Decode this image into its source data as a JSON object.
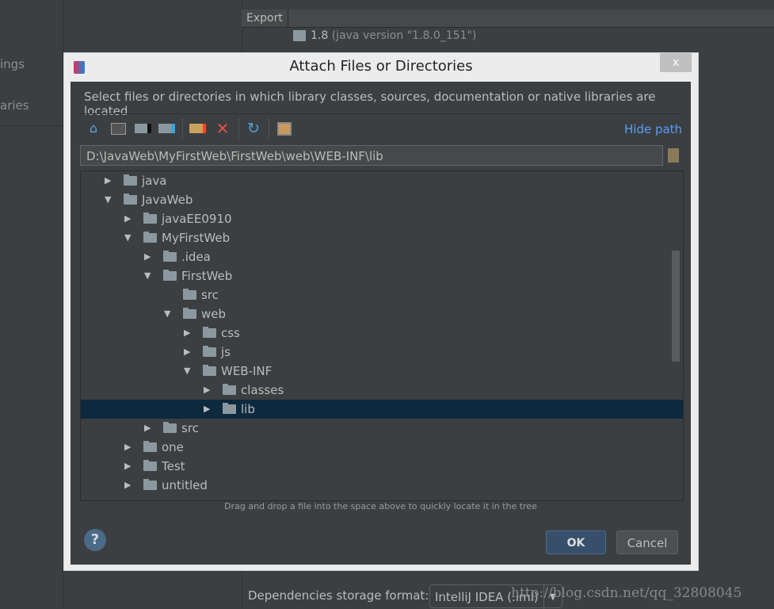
{
  "background": {
    "left_items": [
      "ings",
      "aries"
    ],
    "export_header": "Export",
    "jdk": {
      "name": "1.8",
      "version": "(java version \"1.8.0_151\")"
    },
    "dependencies_label": "Dependencies storage format:",
    "dependencies_value": "IntelliJ IDEA (.iml)",
    "watermark": "http://blog.csdn.net/qq_32808045"
  },
  "dialog": {
    "title": "Attach Files or Directories",
    "close": "x",
    "description": "Select files or directories in which library classes, sources, documentation or native libraries are located",
    "toolbar": {
      "icons": [
        "home-icon",
        "desktop-icon",
        "project-folder-icon",
        "module-folder-icon",
        "new-folder-icon",
        "delete-icon",
        "refresh-icon",
        "show-hidden-icon"
      ],
      "hide_path": "Hide path"
    },
    "path": "D:\\JavaWeb\\MyFirstWeb\\FirstWeb\\web\\WEB-INF\\lib",
    "tree": [
      {
        "label": "java",
        "level": 0,
        "state": "collapsed"
      },
      {
        "label": "JavaWeb",
        "level": 0,
        "state": "expanded"
      },
      {
        "label": "javaEE0910",
        "level": 1,
        "state": "collapsed"
      },
      {
        "label": "MyFirstWeb",
        "level": 1,
        "state": "expanded"
      },
      {
        "label": ".idea",
        "level": 2,
        "state": "collapsed"
      },
      {
        "label": "FirstWeb",
        "level": 2,
        "state": "expanded"
      },
      {
        "label": "src",
        "level": 3,
        "state": "leaf"
      },
      {
        "label": "web",
        "level": 3,
        "state": "expanded"
      },
      {
        "label": "css",
        "level": 4,
        "state": "collapsed"
      },
      {
        "label": "js",
        "level": 4,
        "state": "collapsed"
      },
      {
        "label": "WEB-INF",
        "level": 4,
        "state": "expanded"
      },
      {
        "label": "classes",
        "level": 5,
        "state": "collapsed"
      },
      {
        "label": "lib",
        "level": 5,
        "state": "collapsed",
        "selected": true
      },
      {
        "label": "src",
        "level": 2,
        "state": "collapsed"
      },
      {
        "label": "one",
        "level": 1,
        "state": "collapsed"
      },
      {
        "label": "Test",
        "level": 1,
        "state": "collapsed"
      },
      {
        "label": "untitled",
        "level": 1,
        "state": "collapsed"
      }
    ],
    "hint": "Drag and drop a file into the space above to quickly locate it in the tree",
    "help": "?",
    "ok": "OK",
    "cancel": "Cancel"
  }
}
